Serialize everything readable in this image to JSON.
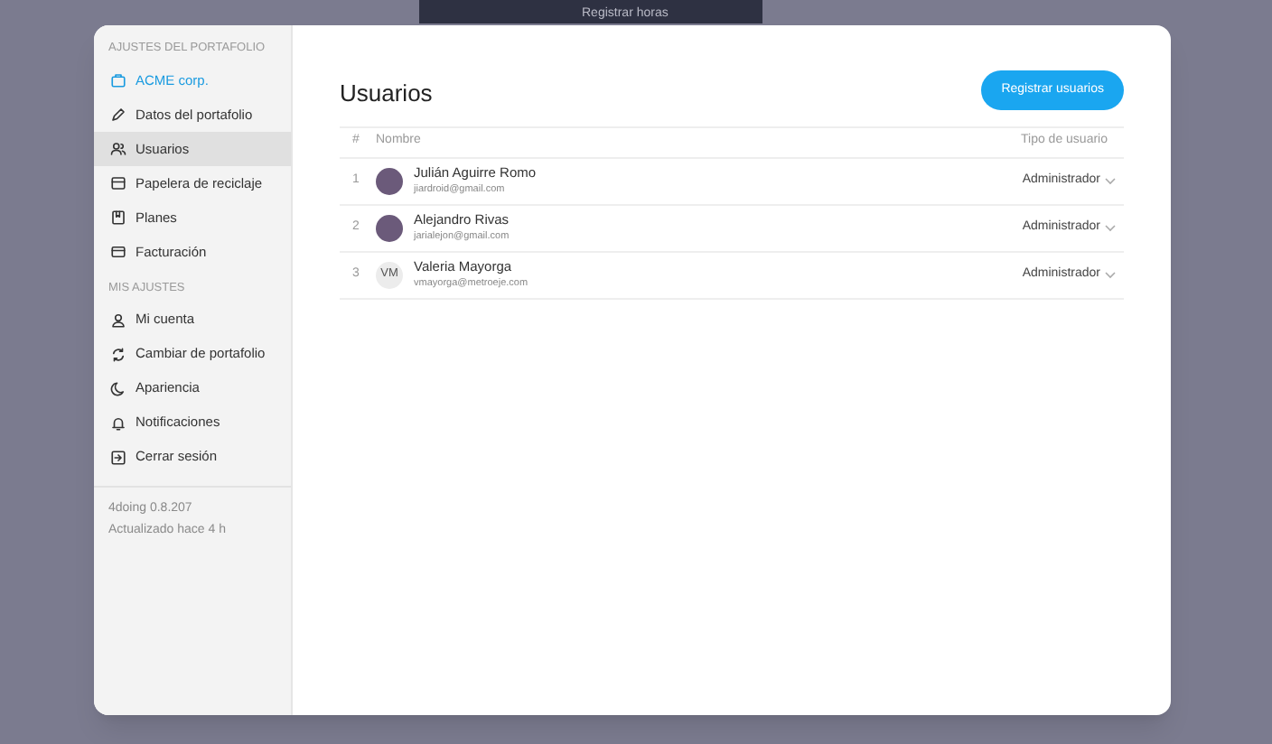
{
  "background": {
    "top_text": "Registrar horas"
  },
  "sidebar": {
    "sections": [
      {
        "title": "AJUSTES DEL PORTAFOLIO",
        "items": [
          {
            "label": "ACME corp.",
            "kind": "briefcase",
            "selected": false,
            "accent": true
          },
          {
            "label": "Datos del portafolio",
            "kind": "pencil",
            "selected": false,
            "accent": false
          },
          {
            "label": "Usuarios",
            "kind": "users",
            "selected": true,
            "accent": false
          },
          {
            "label": "Papelera de reciclaje",
            "kind": "tray",
            "selected": false,
            "accent": false
          },
          {
            "label": "Planes",
            "kind": "book",
            "selected": false,
            "accent": false
          },
          {
            "label": "Facturación",
            "kind": "card",
            "selected": false,
            "accent": false
          }
        ]
      },
      {
        "title": "MIS AJUSTES",
        "items": [
          {
            "label": "Mi cuenta",
            "kind": "user",
            "selected": false,
            "accent": false
          },
          {
            "label": "Cambiar de portafolio",
            "kind": "switch",
            "selected": false,
            "accent": false
          },
          {
            "label": "Apariencia",
            "kind": "moon",
            "selected": false,
            "accent": false
          },
          {
            "label": "Notificaciones",
            "kind": "bell",
            "selected": false,
            "accent": false
          },
          {
            "label": "Cerrar sesión",
            "kind": "logout",
            "selected": false,
            "accent": false
          }
        ]
      }
    ],
    "version": "4doing 0.8.207",
    "updated": "Actualizado hace 4 h"
  },
  "main": {
    "title": "Usuarios",
    "register_button": "Registrar usuarios",
    "table": {
      "columns": [
        "#",
        "Nombre",
        "Tipo de usuario"
      ],
      "rows": [
        {
          "index": "1",
          "name": "Julián Aguirre Romo",
          "email": "jiardroid@gmail.com",
          "kind": "photo",
          "role": "Administrador"
        },
        {
          "index": "2",
          "name": "Alejandro Rivas",
          "email": "jarialejon@gmail.com",
          "kind": "photo",
          "role": "Administrador"
        },
        {
          "index": "3",
          "name": "Valeria Mayorga",
          "email": "vmayorga@metroeje.com",
          "kind": "initials",
          "initials": "VM",
          "role": "Administrador"
        }
      ]
    }
  }
}
